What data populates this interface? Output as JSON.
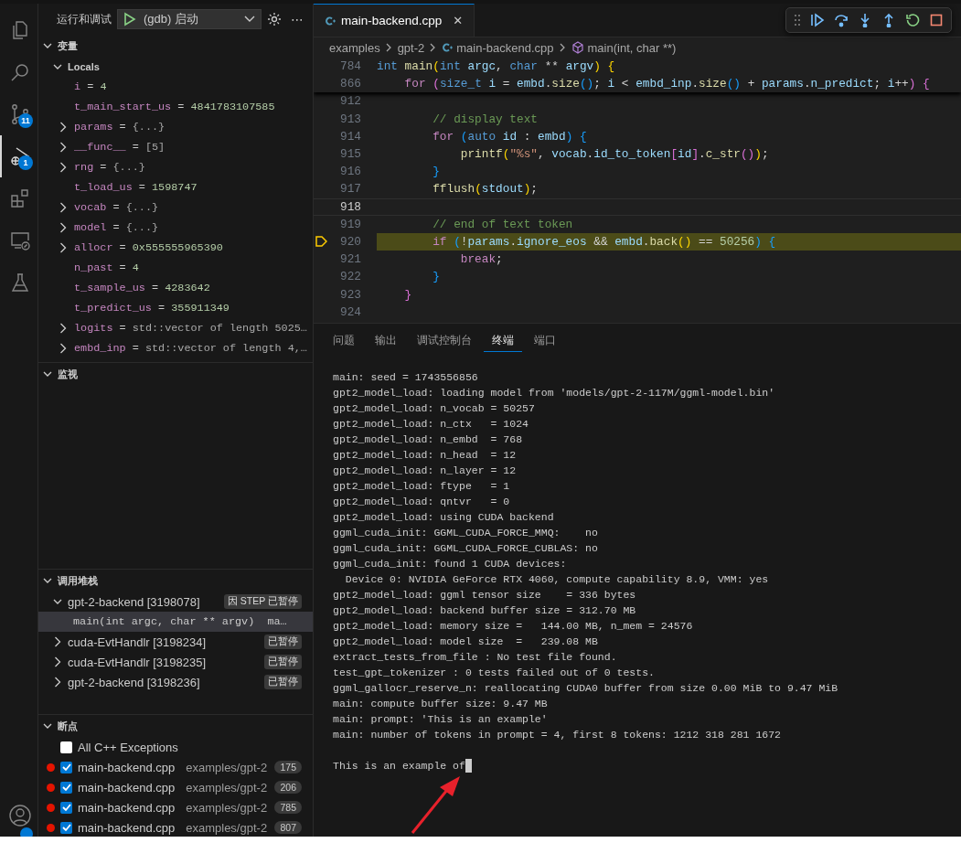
{
  "activity_bar": {
    "items": [
      {
        "kind": "files",
        "selected": false
      },
      {
        "kind": "search",
        "selected": false
      },
      {
        "kind": "source-control",
        "selected": false,
        "badge": "11"
      },
      {
        "kind": "run-debug",
        "selected": true,
        "badge": "1"
      },
      {
        "kind": "extensions",
        "selected": false
      },
      {
        "kind": "remote",
        "selected": false
      },
      {
        "kind": "testing",
        "selected": false
      }
    ],
    "account": {
      "kind": "account"
    }
  },
  "sidebar": {
    "title": "运行和调试",
    "launch_config": "(gdb) 启动",
    "more": "⋯",
    "variables": {
      "title": "变量",
      "expanded": true,
      "scope": "Locals",
      "items": [
        {
          "name": "i",
          "op": "=",
          "value": "4",
          "kind": "num",
          "expandable": false
        },
        {
          "name": "t_main_start_us",
          "op": "=",
          "value": "4841783107585",
          "kind": "num",
          "expandable": false
        },
        {
          "name": "params",
          "op": "=",
          "value": "{...}",
          "kind": "other",
          "expandable": true
        },
        {
          "name": "__func__",
          "op": "=",
          "value": "[5]",
          "kind": "other",
          "expandable": true
        },
        {
          "name": "rng",
          "op": "=",
          "value": "{...}",
          "kind": "other",
          "expandable": true
        },
        {
          "name": "t_load_us",
          "op": "=",
          "value": "1598747",
          "kind": "num",
          "expandable": false
        },
        {
          "name": "vocab",
          "op": "=",
          "value": "{...}",
          "kind": "other",
          "expandable": true
        },
        {
          "name": "model",
          "op": "=",
          "value": "{...}",
          "kind": "other",
          "expandable": true
        },
        {
          "name": "allocr",
          "op": "=",
          "value": "0x555555965390",
          "kind": "num",
          "expandable": true
        },
        {
          "name": "n_past",
          "op": "=",
          "value": "4",
          "kind": "num",
          "expandable": false
        },
        {
          "name": "t_sample_us",
          "op": "=",
          "value": "4283642",
          "kind": "num",
          "expandable": false
        },
        {
          "name": "t_predict_us",
          "op": "=",
          "value": "355911349",
          "kind": "num",
          "expandable": false
        },
        {
          "name": "logits",
          "op": "=",
          "value": "std::vector of length 5025…",
          "kind": "other",
          "expandable": true
        },
        {
          "name": "embd_inp",
          "op": "=",
          "value": "std::vector of length 4,…",
          "kind": "other",
          "expandable": true
        }
      ]
    },
    "watch": {
      "title": "监视",
      "expanded": true
    },
    "call_stack": {
      "title": "调用堆栈",
      "expanded": true,
      "threads": [
        {
          "name": "gpt-2-backend [3198078]",
          "expanded": true,
          "status": "因 STEP 已暂停",
          "frames": [
            {
              "text": "main(int argc, char ** argv)  ma…",
              "selected": true
            }
          ]
        },
        {
          "name": "cuda-EvtHandlr [3198234]",
          "expanded": false,
          "status": "已暂停"
        },
        {
          "name": "cuda-EvtHandlr [3198235]",
          "expanded": false,
          "status": "已暂停"
        },
        {
          "name": "gpt-2-backend [3198236]",
          "expanded": false,
          "status": "已暂停"
        }
      ]
    },
    "breakpoints": {
      "title": "断点",
      "expanded": true,
      "items": [
        {
          "kind": "exception",
          "label": "All C++ Exceptions",
          "checked": false
        },
        {
          "kind": "line",
          "file": "main-backend.cpp",
          "path": "examples/gpt-2",
          "line": "175",
          "checked": true
        },
        {
          "kind": "line",
          "file": "main-backend.cpp",
          "path": "examples/gpt-2",
          "line": "206",
          "checked": true
        },
        {
          "kind": "line",
          "file": "main-backend.cpp",
          "path": "examples/gpt-2",
          "line": "785",
          "checked": true
        },
        {
          "kind": "line",
          "file": "main-backend.cpp",
          "path": "examples/gpt-2",
          "line": "807",
          "checked": true
        }
      ]
    }
  },
  "editor": {
    "tabs": [
      {
        "label": "main-backend.cpp",
        "selected": true,
        "close": "✕"
      }
    ],
    "breadcrumb": [
      {
        "kind": "folder",
        "text": "examples"
      },
      {
        "kind": "folder",
        "text": "gpt-2"
      },
      {
        "kind": "file",
        "text": "main-backend.cpp"
      },
      {
        "kind": "symbol",
        "text": "main(int, char **)"
      }
    ],
    "sticky_lines": [
      {
        "number": "784",
        "tokens": [
          {
            "kind": "kw",
            "text": "int "
          },
          {
            "kind": "fn",
            "text": "main"
          },
          {
            "kind": "b1",
            "text": "("
          },
          {
            "kind": "kw",
            "text": "int "
          },
          {
            "kind": "var",
            "text": "argc"
          },
          {
            "kind": "p",
            "text": ", "
          },
          {
            "kind": "kw",
            "text": "char"
          },
          {
            "kind": "p",
            "text": " ** "
          },
          {
            "kind": "var",
            "text": "argv"
          },
          {
            "kind": "b1",
            "text": ") {"
          }
        ]
      },
      {
        "number": "866",
        "tokens": [
          {
            "kind": "ctl",
            "text": "    for "
          },
          {
            "kind": "b2",
            "text": "("
          },
          {
            "kind": "kw",
            "text": "size_t "
          },
          {
            "kind": "var",
            "text": "i"
          },
          {
            "kind": "p",
            "text": " = "
          },
          {
            "kind": "var",
            "text": "embd"
          },
          {
            "kind": "p",
            "text": "."
          },
          {
            "kind": "fn",
            "text": "size"
          },
          {
            "kind": "b3",
            "text": "()"
          },
          {
            "kind": "p",
            "text": "; "
          },
          {
            "kind": "var",
            "text": "i"
          },
          {
            "kind": "p",
            "text": " < "
          },
          {
            "kind": "var",
            "text": "embd_inp"
          },
          {
            "kind": "p",
            "text": "."
          },
          {
            "kind": "fn",
            "text": "size"
          },
          {
            "kind": "b3",
            "text": "()"
          },
          {
            "kind": "p",
            "text": " + "
          },
          {
            "kind": "var",
            "text": "params"
          },
          {
            "kind": "p",
            "text": "."
          },
          {
            "kind": "var",
            "text": "n_predict"
          },
          {
            "kind": "p",
            "text": "; "
          },
          {
            "kind": "var",
            "text": "i"
          },
          {
            "kind": "p",
            "text": "++"
          },
          {
            "kind": "b2",
            "text": ") {"
          }
        ]
      }
    ],
    "lines": [
      {
        "number": "912",
        "active": false,
        "paused": false
      },
      {
        "number": "913",
        "tokens": [
          {
            "kind": "cmt",
            "text": "        // display text"
          }
        ],
        "active": false,
        "paused": false
      },
      {
        "number": "914",
        "tokens": [
          {
            "kind": "ctl",
            "text": "        for "
          },
          {
            "kind": "b3",
            "text": "("
          },
          {
            "kind": "kw",
            "text": "auto "
          },
          {
            "kind": "var",
            "text": "id"
          },
          {
            "kind": "p",
            "text": " : "
          },
          {
            "kind": "var",
            "text": "embd"
          },
          {
            "kind": "b3",
            "text": ") {"
          }
        ],
        "active": false,
        "paused": false
      },
      {
        "number": "915",
        "tokens": [
          {
            "kind": "fn",
            "text": "            printf"
          },
          {
            "kind": "b1",
            "text": "("
          },
          {
            "kind": "str",
            "text": "\"%s\""
          },
          {
            "kind": "p",
            "text": ", "
          },
          {
            "kind": "var",
            "text": "vocab"
          },
          {
            "kind": "p",
            "text": "."
          },
          {
            "kind": "var",
            "text": "id_to_token"
          },
          {
            "kind": "b2",
            "text": "["
          },
          {
            "kind": "var",
            "text": "id"
          },
          {
            "kind": "b2",
            "text": "]"
          },
          {
            "kind": "p",
            "text": "."
          },
          {
            "kind": "fn",
            "text": "c_str"
          },
          {
            "kind": "b2",
            "text": "()"
          },
          {
            "kind": "b1",
            "text": ")"
          },
          {
            "kind": "p",
            "text": ";"
          }
        ],
        "active": false,
        "paused": false
      },
      {
        "number": "916",
        "tokens": [
          {
            "kind": "b3",
            "text": "        }"
          }
        ],
        "active": false,
        "paused": false
      },
      {
        "number": "917",
        "tokens": [
          {
            "kind": "fn",
            "text": "        fflush"
          },
          {
            "kind": "b1",
            "text": "("
          },
          {
            "kind": "var",
            "text": "stdout"
          },
          {
            "kind": "b1",
            "text": ")"
          },
          {
            "kind": "p",
            "text": ";"
          }
        ],
        "active": false,
        "paused": false
      },
      {
        "number": "918",
        "active": true,
        "paused": false
      },
      {
        "number": "919",
        "tokens": [
          {
            "kind": "cmt",
            "text": "        // end of text token"
          }
        ],
        "active": false,
        "paused": false
      },
      {
        "number": "920",
        "tokens": [
          {
            "kind": "ctl",
            "text": "        if "
          },
          {
            "kind": "b3",
            "text": "("
          },
          {
            "kind": "p",
            "text": "!"
          },
          {
            "kind": "var",
            "text": "params"
          },
          {
            "kind": "p",
            "text": "."
          },
          {
            "kind": "var",
            "text": "ignore_eos"
          },
          {
            "kind": "p",
            "text": " && "
          },
          {
            "kind": "var",
            "text": "embd"
          },
          {
            "kind": "p",
            "text": "."
          },
          {
            "kind": "fn",
            "text": "back"
          },
          {
            "kind": "b1",
            "text": "()"
          },
          {
            "kind": "p",
            "text": " == "
          },
          {
            "kind": "num",
            "text": "50256"
          },
          {
            "kind": "b3",
            "text": ") {"
          }
        ],
        "active": false,
        "paused": true
      },
      {
        "number": "921",
        "tokens": [
          {
            "kind": "ctl",
            "text": "            break"
          },
          {
            "kind": "p",
            "text": ";"
          }
        ],
        "active": false,
        "paused": false
      },
      {
        "number": "922",
        "tokens": [
          {
            "kind": "b3",
            "text": "        }"
          }
        ],
        "active": false,
        "paused": false
      },
      {
        "number": "923",
        "tokens": [
          {
            "kind": "b2",
            "text": "    }"
          }
        ],
        "active": false,
        "paused": false
      },
      {
        "number": "924",
        "active": false,
        "paused": false
      }
    ]
  },
  "panel": {
    "tabs": [
      {
        "label": "问题",
        "selected": false
      },
      {
        "label": "输出",
        "selected": false
      },
      {
        "label": "调试控制台",
        "selected": false
      },
      {
        "label": "终端",
        "selected": true
      },
      {
        "label": "端口",
        "selected": false
      }
    ],
    "terminal": {
      "lines": [
        {
          "text": "main: seed = 1743556856",
          "blank_before": false
        },
        {
          "text": "gpt2_model_load: loading model from 'models/gpt-2-117M/ggml-model.bin'",
          "blank_before": false
        },
        {
          "text": "gpt2_model_load: n_vocab = 50257",
          "blank_before": false
        },
        {
          "text": "gpt2_model_load: n_ctx   = 1024",
          "blank_before": false
        },
        {
          "text": "gpt2_model_load: n_embd  = 768",
          "blank_before": false
        },
        {
          "text": "gpt2_model_load: n_head  = 12",
          "blank_before": false
        },
        {
          "text": "gpt2_model_load: n_layer = 12",
          "blank_before": false
        },
        {
          "text": "gpt2_model_load: ftype   = 1",
          "blank_before": false
        },
        {
          "text": "gpt2_model_load: qntvr   = 0",
          "blank_before": false
        },
        {
          "text": "gpt2_model_load: using CUDA backend",
          "blank_before": false
        },
        {
          "text": "ggml_cuda_init: GGML_CUDA_FORCE_MMQ:    no",
          "blank_before": false
        },
        {
          "text": "ggml_cuda_init: GGML_CUDA_FORCE_CUBLAS: no",
          "blank_before": false
        },
        {
          "text": "ggml_cuda_init: found 1 CUDA devices:",
          "blank_before": false
        },
        {
          "text": "  Device 0: NVIDIA GeForce RTX 4060, compute capability 8.9, VMM: yes",
          "blank_before": false
        },
        {
          "text": "gpt2_model_load: ggml tensor size    = 336 bytes",
          "blank_before": false
        },
        {
          "text": "gpt2_model_load: backend buffer size = 312.70 MB",
          "blank_before": false
        },
        {
          "text": "gpt2_model_load: memory size =   144.00 MB, n_mem = 24576",
          "blank_before": false
        },
        {
          "text": "gpt2_model_load: model size  =   239.08 MB",
          "blank_before": false
        },
        {
          "text": "extract_tests_from_file : No test file found.",
          "blank_before": false
        },
        {
          "text": "test_gpt_tokenizer : 0 tests failed out of 0 tests.",
          "blank_before": false
        },
        {
          "text": "ggml_gallocr_reserve_n: reallocating CUDA0 buffer from size 0.00 MiB to 9.47 MiB",
          "blank_before": false
        },
        {
          "text": "main: compute buffer size: 9.47 MB",
          "blank_before": false
        },
        {
          "text": "main: prompt: 'This is an example'",
          "blank_before": false
        },
        {
          "text": "main: number of tokens in prompt = 4, first 8 tokens: 1212 318 281 1672",
          "blank_before": false
        },
        {
          "text": "This is an example of",
          "blank_before": true
        }
      ],
      "cursor": true
    }
  }
}
